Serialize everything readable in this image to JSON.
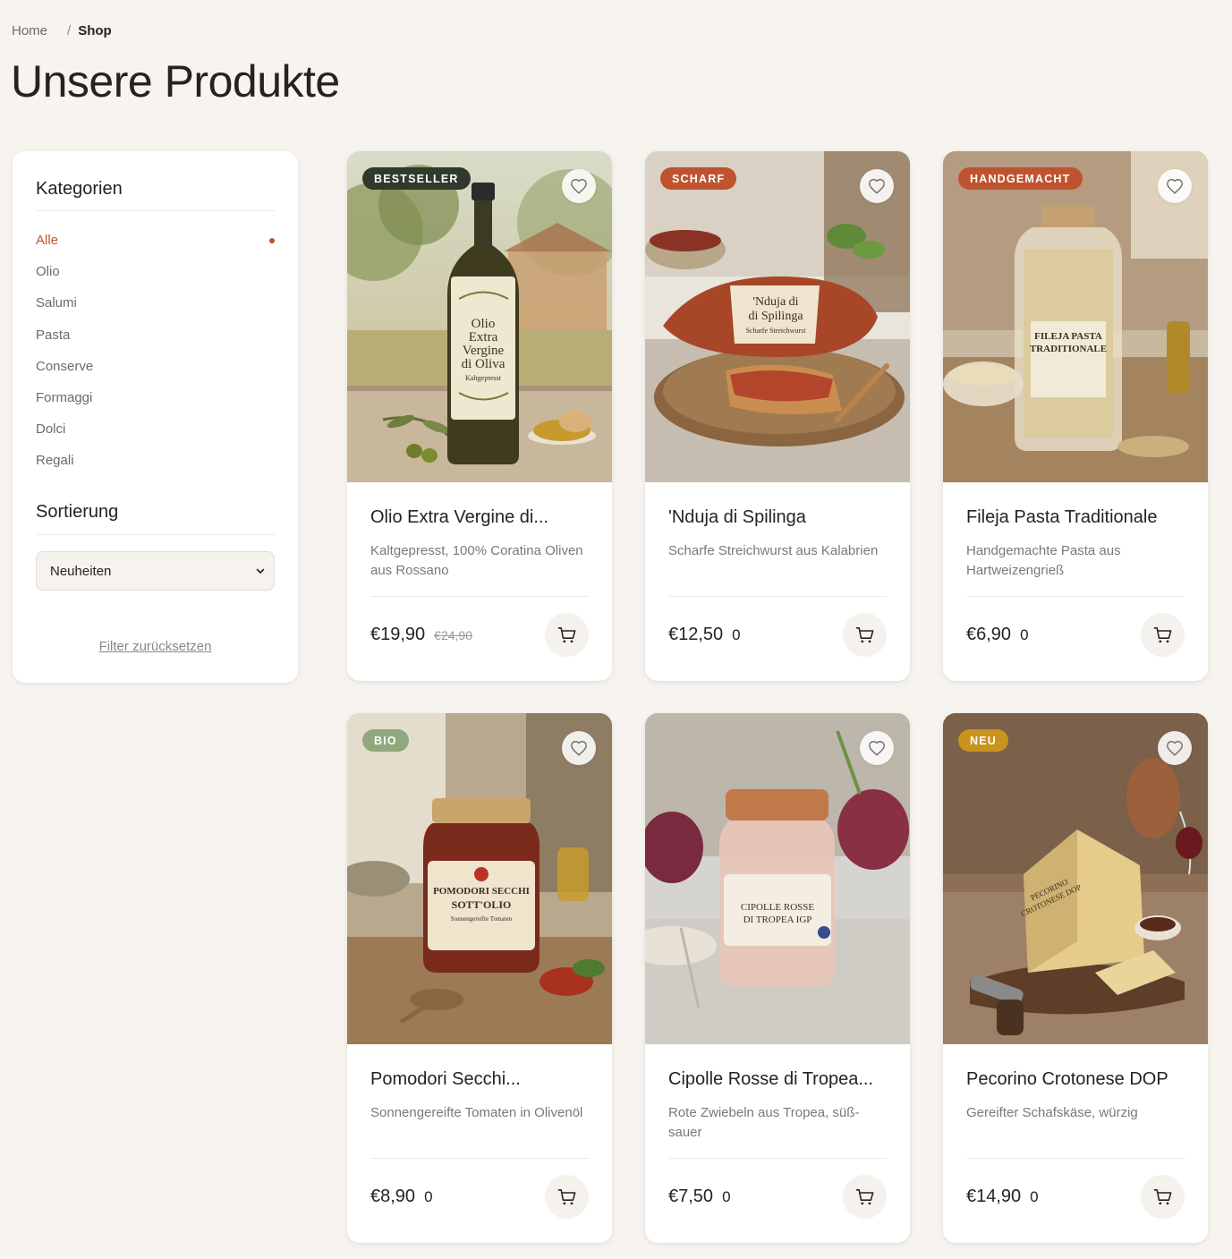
{
  "breadcrumb": {
    "home": "Home",
    "separator": "/",
    "current": "Shop"
  },
  "page_title": "Unsere Produkte",
  "sidebar": {
    "categories_title": "Kategorien",
    "categories": [
      "Alle",
      "Olio",
      "Salumi",
      "Pasta",
      "Conserve",
      "Formaggi",
      "Dolci",
      "Regali"
    ],
    "active_category": "Alle",
    "sort_title": "Sortierung",
    "sort_selected": "Neuheiten",
    "reset_label": "Filter zurücksetzen"
  },
  "colors": {
    "accent": "#c0532f",
    "background": "#f7f4ef",
    "badge_bestseller": "#2f3a2c",
    "badge_scharf": "#c0532f",
    "badge_handgemacht": "#c0532f",
    "badge_bio": "#8fa87e",
    "badge_neu": "#c8941d"
  },
  "products": [
    {
      "badge": "BESTSELLER",
      "name": "Olio Extra Vergine di...",
      "desc": "Kaltgepresst, 100% Coratina Oliven aus Rossano",
      "price": "€19,90",
      "old_price": "€24,90",
      "count": ""
    },
    {
      "badge": "SCHARF",
      "name": "'Nduja di Spilinga",
      "desc": "Scharfe Streichwurst aus Kalabrien",
      "price": "€12,50",
      "old_price": "",
      "count": "0"
    },
    {
      "badge": "HANDGEMACHT",
      "name": "Fileja Pasta Traditionale",
      "desc": "Handgemachte Pasta aus Hartweizengrieß",
      "price": "€6,90",
      "old_price": "",
      "count": "0"
    },
    {
      "badge": "BIO",
      "name": "Pomodori Secchi...",
      "desc": "Sonnengereifte Tomaten in Olivenöl",
      "price": "€8,90",
      "old_price": "",
      "count": "0"
    },
    {
      "badge": "",
      "name": "Cipolle Rosse di Tropea...",
      "desc": "Rote Zwiebeln aus Tropea, süß-sauer",
      "price": "€7,50",
      "old_price": "",
      "count": "0"
    },
    {
      "badge": "NEU",
      "name": "Pecorino Crotonese DOP",
      "desc": "Gereifter Schafskäse, würzig",
      "price": "€14,90",
      "old_price": "",
      "count": "0"
    }
  ],
  "labels": {
    "p0": [
      "Olio",
      "Extra",
      "Vergine",
      "di Oliva",
      "Kaltgepresst"
    ],
    "p1": [
      "'Nduja di",
      "di Spilinga",
      "Scharfe Streichwurst"
    ],
    "p2": [
      "FILEJA PASTA",
      "TRADITIONALE"
    ],
    "p3": [
      "POMODORI SECCHI",
      "SOTT'OLIO",
      "Sonnengereifte Tomaten"
    ],
    "p4": [
      "CIPOLLE ROSSE",
      "DI TROPEA IGP"
    ],
    "p5": [
      "PECORINO",
      "CROTONESE DOP"
    ]
  },
  "icons": {
    "favorite": "heart-icon",
    "cart": "cart-icon",
    "sort": "chevron-down-icon"
  }
}
